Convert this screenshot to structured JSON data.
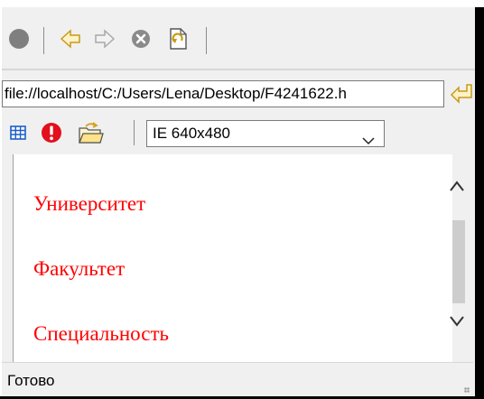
{
  "toolbar": {
    "buttons": [
      {
        "icon": "stop-circle-icon"
      },
      {
        "icon": "back-arrow-icon"
      },
      {
        "icon": "forward-arrow-icon"
      },
      {
        "icon": "cancel-icon"
      },
      {
        "icon": "refresh-page-icon"
      }
    ]
  },
  "address_bar": {
    "value": "file://localhost/C:/Users/Lena/Desktop/F4241622.h",
    "go_icon": "go-arrow-icon"
  },
  "tools": {
    "icons": [
      "grid-icon",
      "error-icon",
      "open-folder-icon"
    ],
    "viewport_select": "IE 640x480"
  },
  "page": {
    "headings": [
      "Университет",
      "Факультет",
      "Специальность"
    ],
    "heading_color": "#ff0000"
  },
  "status": {
    "text": "Готово"
  }
}
